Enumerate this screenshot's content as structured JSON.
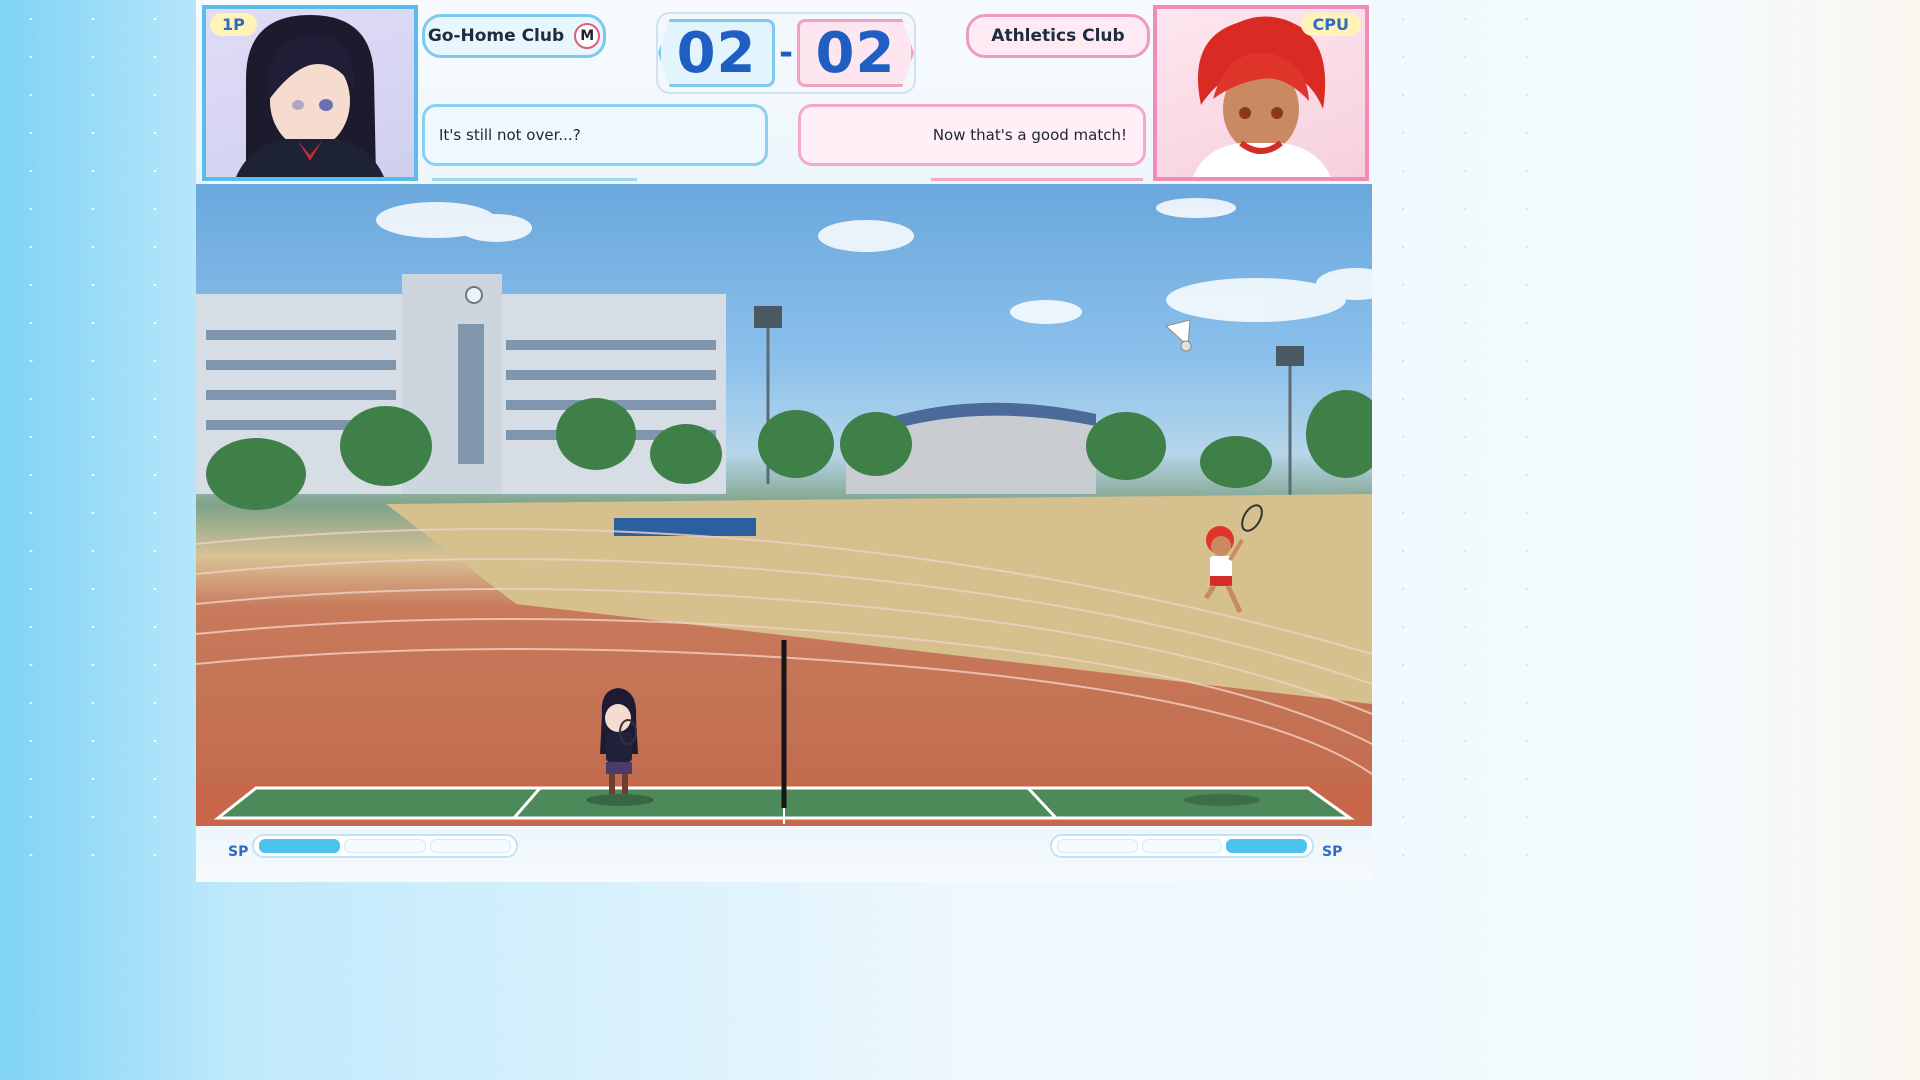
{
  "players": {
    "left": {
      "tag": "1P",
      "club": "Go-Home Club",
      "club_badge": "M",
      "dialogue": "It's still not over...?"
    },
    "right": {
      "tag": "CPU",
      "club": "Athletics Club",
      "dialogue": "Now that's a good match!"
    }
  },
  "score": {
    "left": "02",
    "separator": "-",
    "right": "02"
  },
  "sp": {
    "left": {
      "label": "SP",
      "segments": 3,
      "filled": 1
    },
    "right": {
      "label": "SP",
      "segments": 3,
      "filled": 1
    }
  },
  "colors": {
    "p1_accent": "#5bbbe9",
    "cpu_accent": "#f08cb5",
    "score_text": "#1f5fc4",
    "sp_fill": "#4cc3ef"
  }
}
